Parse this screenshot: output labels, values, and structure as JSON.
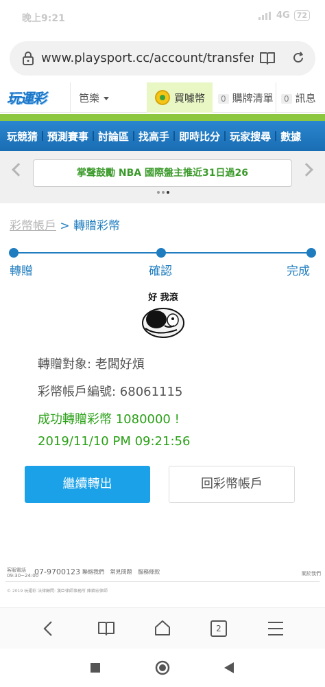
{
  "status": {
    "time": "晚上9:21",
    "network": "4G",
    "battery": "72"
  },
  "browser": {
    "url": "www.playsport.cc/account/transfer/st",
    "tabs": "2"
  },
  "header": {
    "logo": "玩運彩",
    "user": "笆樂",
    "coin": "買噱幣",
    "cart_count": "0",
    "cart": "購牌清單",
    "msg_count": "0",
    "msg": "訊息"
  },
  "nav": {
    "items": [
      "玩競猜",
      "預測賽事",
      "討論區",
      "找高手",
      "即時比分",
      "玩家搜尋",
      "數據"
    ]
  },
  "marquee": {
    "text": "掌聲鼓勵 NBA 國際盤主推近31日過26"
  },
  "breadcrumb": {
    "root": "彩幣帳戶",
    "sep": ">",
    "current": "轉贈彩幣"
  },
  "steps": [
    "轉贈",
    "確認",
    "完成"
  ],
  "meme": {
    "caption": "好 我滾"
  },
  "result": {
    "target": "轉贈對象: 老闆好煩",
    "account": "彩幣帳戶編號: 68061115",
    "success": "成功轉贈彩幣 1080000 !",
    "datetime": "2019/11/10 PM 09:21:56"
  },
  "buttons": {
    "continue": "繼續轉出",
    "back": "回彩幣帳戶"
  },
  "footer": {
    "service_label_1": "客服電話",
    "service_label_2": "09:30~24:00",
    "phone": "07-9700123",
    "links": [
      "聯絡我們",
      "常見問題",
      "服務條款"
    ],
    "about": "關於我們",
    "copyright": "© 2019 玩運彩 法律顧問: 漢臣律師事務所 陳鎮宏律師"
  },
  "colors": {
    "primary": "#1f7dbf",
    "button": "#1aa1e8",
    "success": "#2aa017",
    "nav_green": "#8dc63f"
  }
}
